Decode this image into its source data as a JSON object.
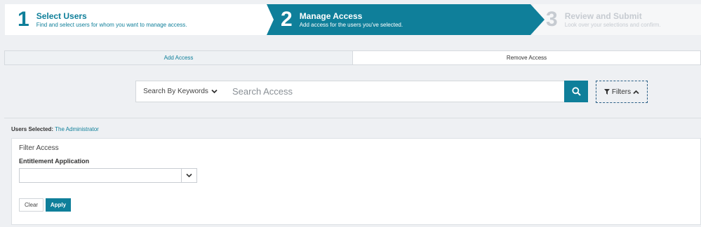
{
  "wizard": {
    "steps": [
      {
        "number": "1",
        "title": "Select Users",
        "subtitle": "Find and select users for whom you want to manage access.",
        "state": "completed"
      },
      {
        "number": "2",
        "title": "Manage Access",
        "subtitle": "Add access for the users you've selected.",
        "state": "active"
      },
      {
        "number": "3",
        "title": "Review and Submit",
        "subtitle": "Look over your selections and confirm.",
        "state": "upcoming"
      }
    ],
    "active_color": "#0f7f9a"
  },
  "tabs": [
    {
      "label": "Add Access",
      "selected": true
    },
    {
      "label": "Remove Access",
      "selected": false
    }
  ],
  "search": {
    "type_label": "Search By Keywords",
    "placeholder": "Search Access",
    "value": "",
    "search_icon": "search-icon",
    "filters_label": "Filters"
  },
  "users_selected": {
    "label": "Users Selected:",
    "value": "The Administrator"
  },
  "filter_panel": {
    "title": "Filter Access",
    "field_label": "Entitlement Application",
    "field_value": "",
    "clear_label": "Clear",
    "apply_label": "Apply"
  }
}
